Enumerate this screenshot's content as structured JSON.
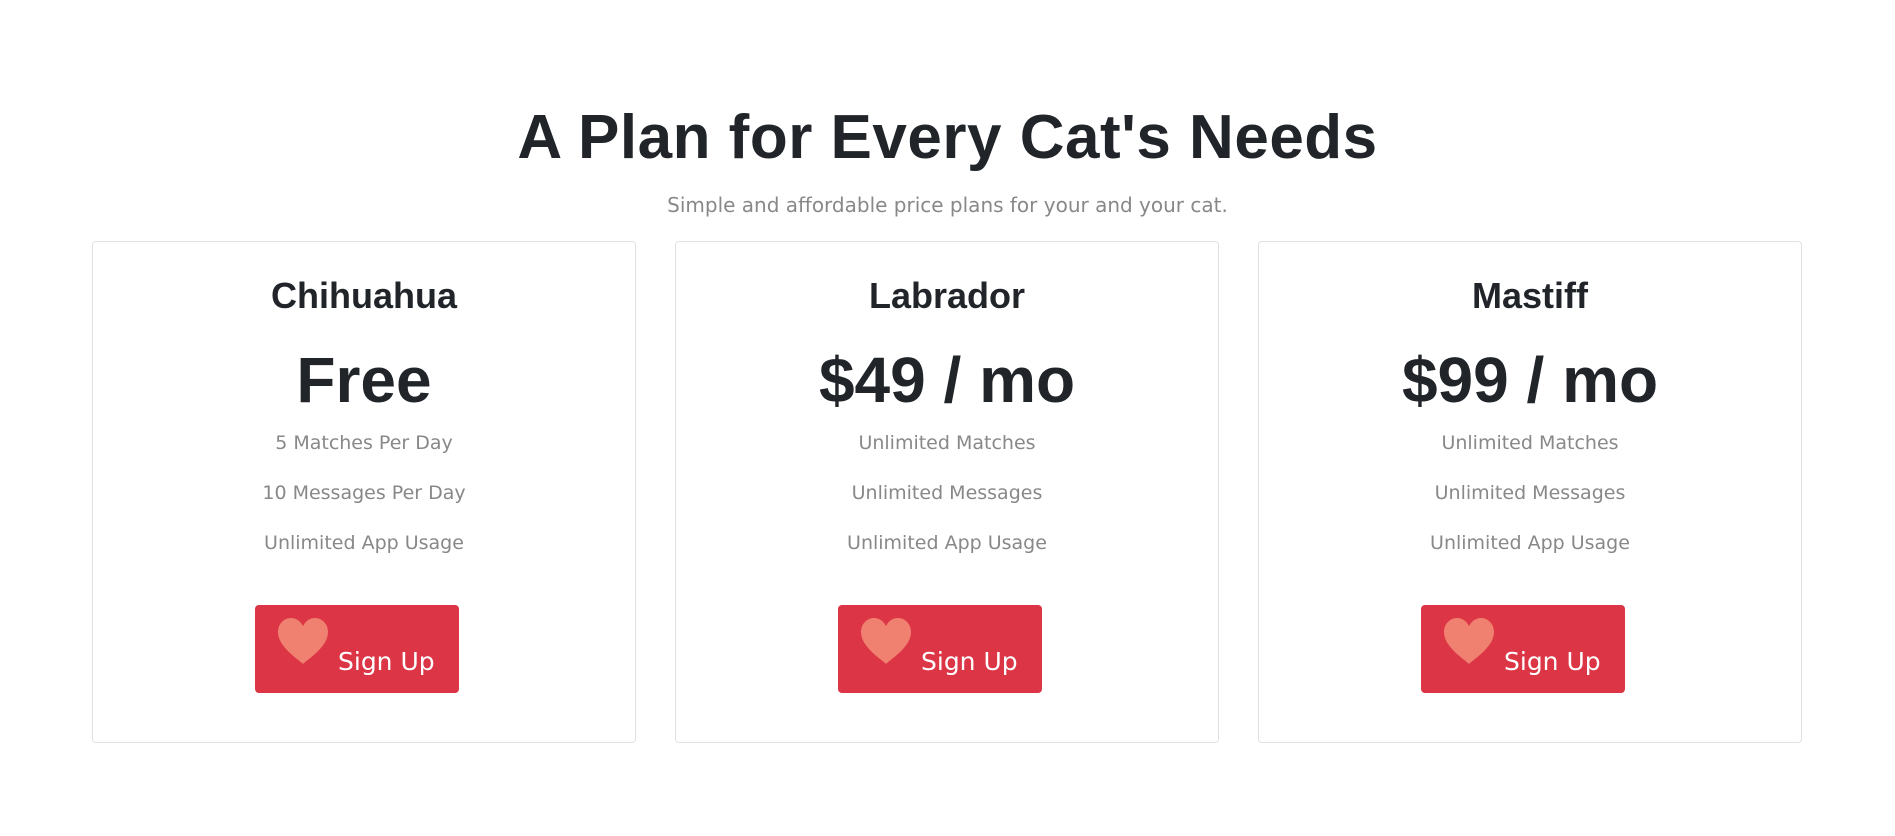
{
  "header": {
    "title": "A Plan for Every Cat's Needs",
    "subtitle": "Simple and affordable price plans for your and your cat."
  },
  "plans": [
    {
      "name": "Chihuahua",
      "price": "Free",
      "features": [
        "5 Matches Per Day",
        "10 Messages Per Day",
        "Unlimited App Usage"
      ],
      "button_label": "Sign Up",
      "button_icon": "heart-icon"
    },
    {
      "name": "Labrador",
      "price": "$49 / mo",
      "features": [
        "Unlimited Matches",
        "Unlimited Messages",
        "Unlimited App Usage"
      ],
      "button_label": "Sign Up",
      "button_icon": "heart-icon"
    },
    {
      "name": "Mastiff",
      "price": "$99 / mo",
      "features": [
        "Unlimited Matches",
        "Unlimited Messages",
        "Unlimited App Usage"
      ],
      "button_label": "Sign Up",
      "button_icon": "heart-icon"
    }
  ],
  "colors": {
    "button": "#dc3545",
    "heart": "#f08070",
    "heading": "#212529",
    "muted": "#888888",
    "border": "#dee2e6"
  }
}
